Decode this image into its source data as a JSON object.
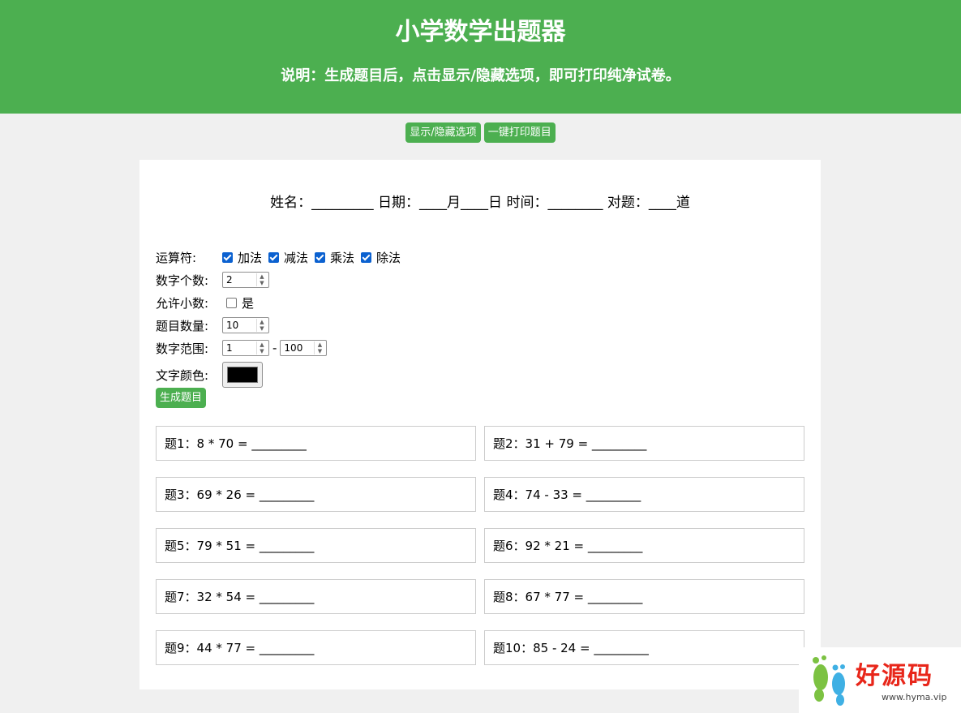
{
  "header": {
    "title": "小学数学出题器",
    "intro": "说明：生成题目后，点击显示/隐藏选项，即可打印纯净试卷。"
  },
  "toolbar": {
    "toggle_label": "显示/隐藏选项",
    "print_label": "一键打印题目"
  },
  "info_line": "姓名：_________ 日期：____月____日 时间：________ 对题：____道",
  "options": {
    "operators_label": "运算符:",
    "operators": [
      {
        "label": "加法",
        "checked": true
      },
      {
        "label": "减法",
        "checked": true
      },
      {
        "label": "乘法",
        "checked": true
      },
      {
        "label": "除法",
        "checked": true
      }
    ],
    "count_label": "数字个数:",
    "count_value": "2",
    "decimal_label": "允许小数:",
    "decimal_option": "是",
    "decimal_checked": false,
    "quantity_label": "题目数量:",
    "quantity_value": "10",
    "range_label": "数字范围:",
    "range_min": "1",
    "range_sep": "-",
    "range_max": "100",
    "color_label": "文字颜色:",
    "color_value": "#000000",
    "generate_label": "生成题目"
  },
  "problems": [
    "题1：8 * 70 = _________",
    "题2：31 + 79 = _________",
    "题3：69 * 26 = _________",
    "题4：74 - 33 = _________",
    "题5：79 * 51 = _________",
    "题6：92 * 21 = _________",
    "题7：32 * 54 = _________",
    "题8：67 * 77 = _________",
    "题9：44 * 77 = _________",
    "题10：85 - 24 = _________"
  ],
  "watermark": {
    "title": "好源码",
    "url": "www.hyma.vip"
  },
  "colors": {
    "accent": "#4caf50",
    "checkbox": "#0b61d0",
    "watermark": "#e8261a"
  }
}
